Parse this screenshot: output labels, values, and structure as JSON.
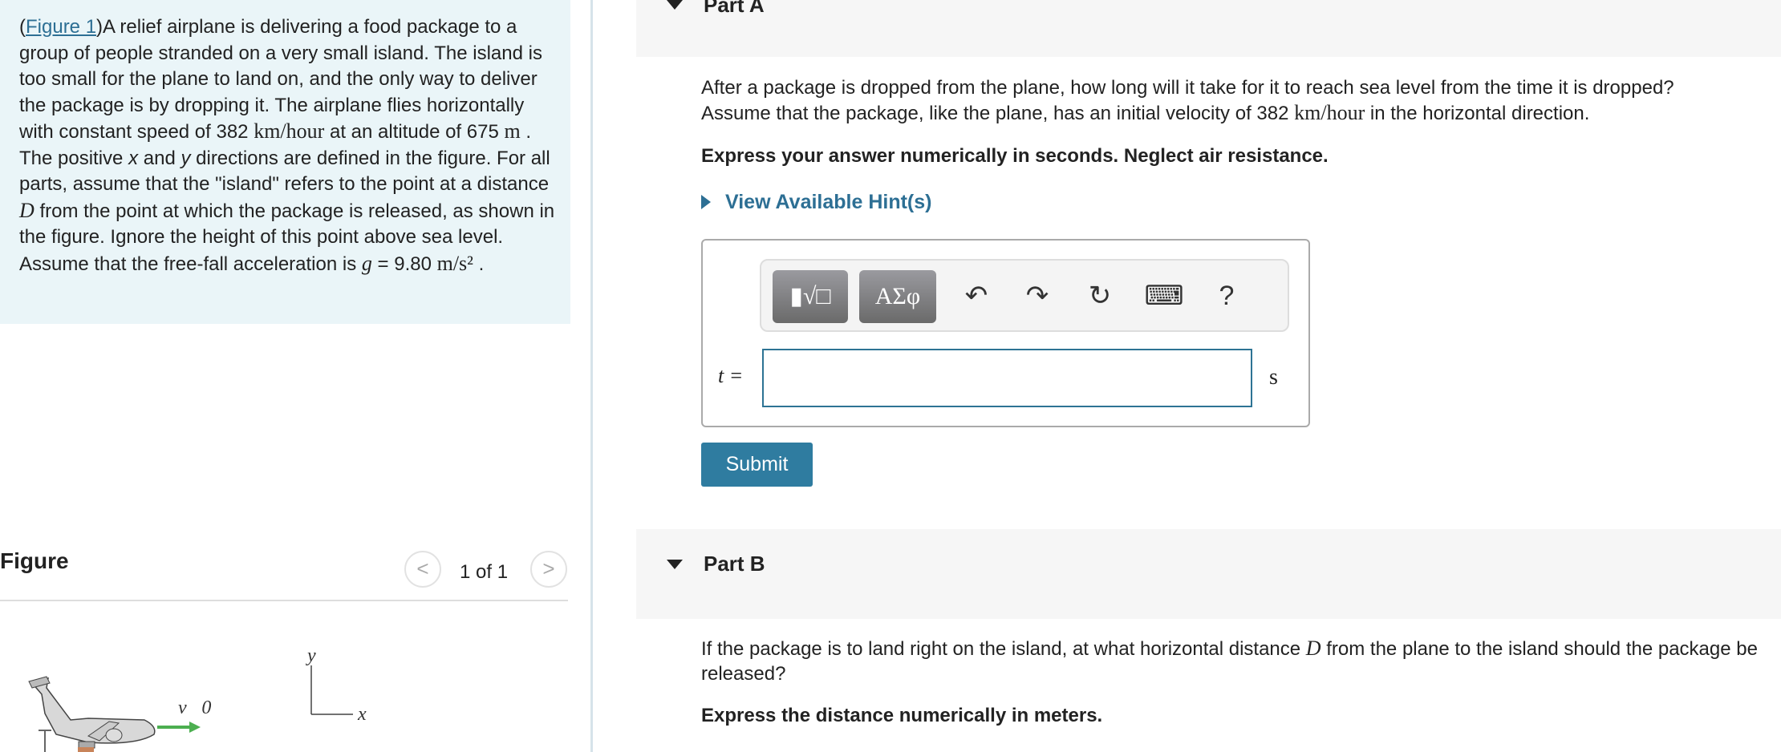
{
  "intro": {
    "figure_link": "Figure 1",
    "text_1": ")A relief airplane is delivering a food package to a group of people stranded on a very small island. The island is too small for the plane to land on, and the only way to deliver the package is by dropping it. The airplane flies horizontally with constant speed of 382 ",
    "speed_unit": "km/hour",
    "text_2": " at an altitude of 675 ",
    "alt_unit": "m",
    "text_3": " . The positive ",
    "x": "x",
    "and": " and ",
    "y": "y",
    "text_4": " directions are defined in the figure. For all parts, assume that the \"island\" refers to the point at a distance ",
    "D": "D",
    "text_5": " from the point at which the package is released, as shown in the figure. Ignore the height of this point above sea level. Assume that the free-fall acceleration is ",
    "g": "g",
    "g_value": " = 9.80 ",
    "g_unit": "m/s²",
    "text_6": " ."
  },
  "figure": {
    "title": "Figure",
    "count": "1 of 1",
    "prev": "<",
    "next": ">",
    "v0_label": "v⃗0",
    "axis_y": "y",
    "axis_x": "x"
  },
  "partA": {
    "title": "Part A",
    "question_1": "After a package is dropped from the plane, how long will it take for it to reach sea level from the time it is dropped?",
    "question_2a": "Assume that the package, like the plane, has an initial velocity of 382 ",
    "question_unit": "km/hour",
    "question_2b": " in the horizontal direction.",
    "instruction": "Express your answer numerically in seconds. Neglect air resistance.",
    "hint": "View Available Hint(s)",
    "toolbar": {
      "templates": "▮√□",
      "symbols": "ΑΣφ",
      "undo": "↶",
      "redo": "↷",
      "reset": "↻",
      "keyboard": "⌨",
      "help": "?"
    },
    "variable": "t =",
    "input_value": "",
    "unit": "s",
    "submit": "Submit"
  },
  "partB": {
    "title": "Part B",
    "question_a": "If the package is to land right on the island, at what horizontal distance ",
    "D": "D",
    "question_b": " from the plane to the island should the package be released?",
    "instruction": "Express the distance numerically in meters."
  },
  "colors": {
    "link": "#2d6f94",
    "submit": "#2f7ca0",
    "intro_bg": "#eaf5f8",
    "arrow": "#4caf50"
  }
}
